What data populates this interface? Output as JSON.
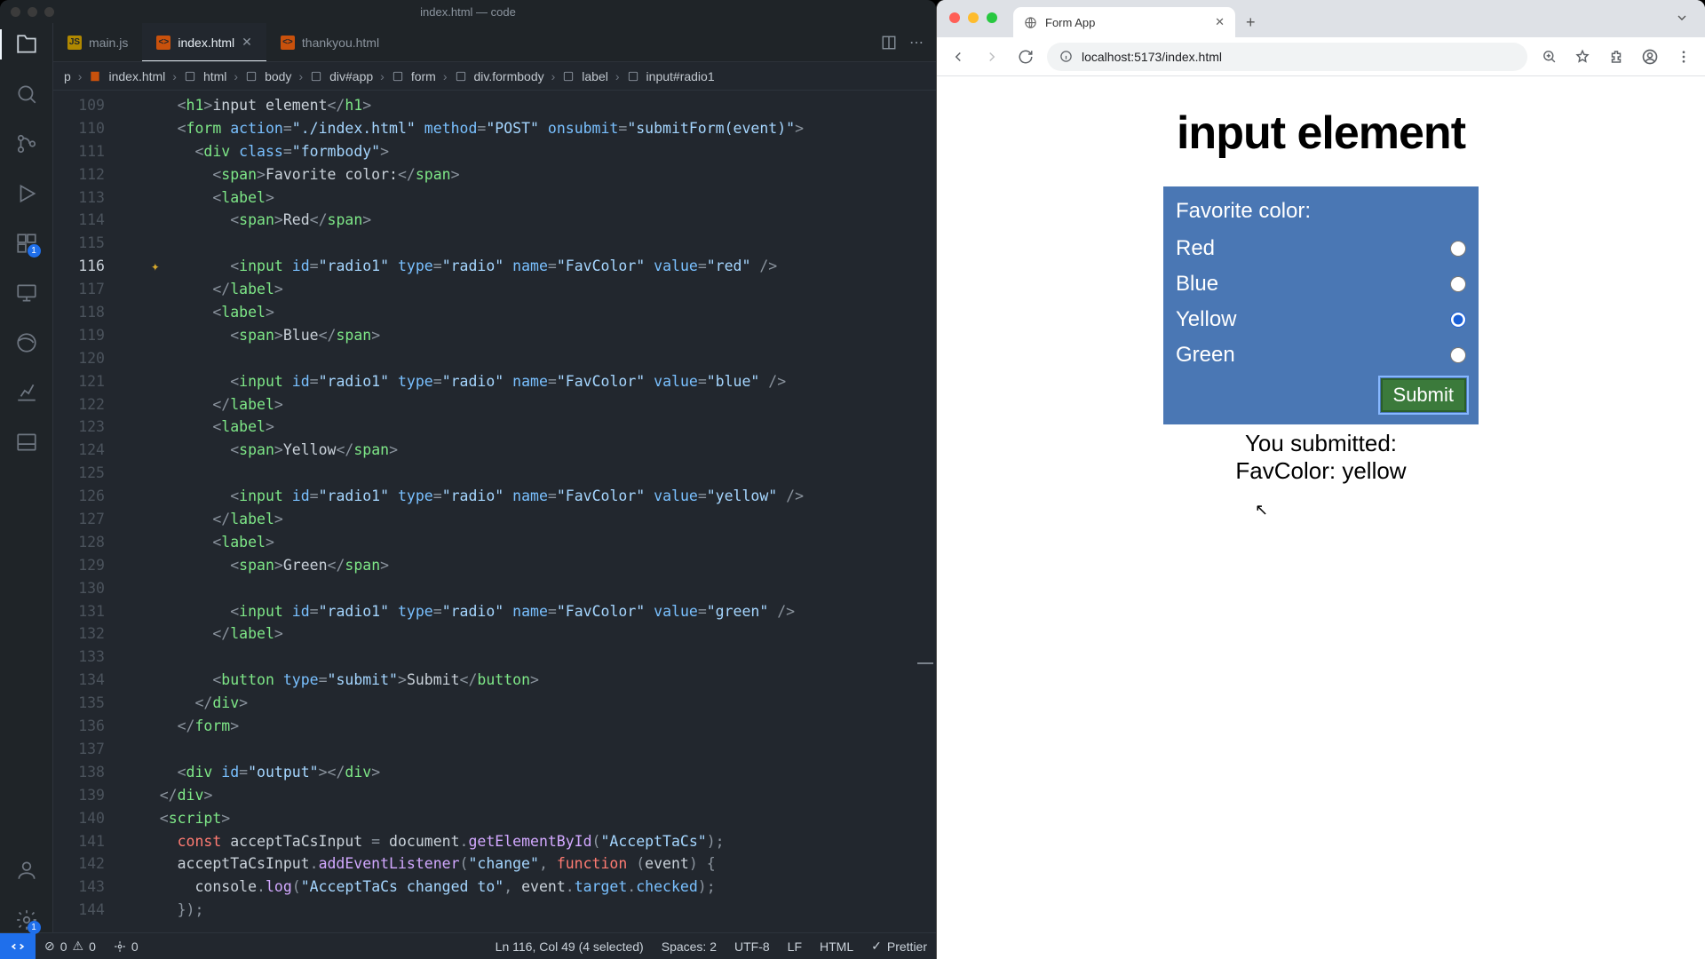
{
  "vscode": {
    "title": "index.html — code",
    "tabs": [
      {
        "icon": "JS",
        "icon_bg": "#b08800",
        "label": "main.js",
        "active": false
      },
      {
        "icon": "<>",
        "icon_bg": "#c9510c",
        "label": "index.html",
        "active": true
      },
      {
        "icon": "<>",
        "icon_bg": "#c9510c",
        "label": "thankyou.html",
        "active": false
      }
    ],
    "breadcrumbs": [
      "p",
      "index.html",
      "html",
      "body",
      "div#app",
      "form",
      "div.formbody",
      "label",
      "input#radio1"
    ],
    "line_start": 109,
    "line_end": 144,
    "highlight_line": 116,
    "status": {
      "errors": "0",
      "warnings": "0",
      "ports": "0",
      "cursor": "Ln 116, Col 49 (4 selected)",
      "spaces": "Spaces: 2",
      "encoding": "UTF-8",
      "eol": "LF",
      "lang": "HTML",
      "formatter": "Prettier"
    },
    "ext_badge": "1",
    "settings_badge": "1"
  },
  "browser": {
    "tab_title": "Form App",
    "url": "localhost:5173/index.html",
    "page": {
      "heading": "input element",
      "prompt": "Favorite color:",
      "options": [
        "Red",
        "Blue",
        "Yellow",
        "Green"
      ],
      "selected_index": 2,
      "submit_label": "Submit",
      "output_line1": "You submitted:",
      "output_line2": "FavColor: yellow"
    }
  },
  "code_lines": [
    {
      "n": 109,
      "html": "      <span class='t-pun'>&lt;</span><span class='t-tag'>h1</span><span class='t-pun'>&gt;</span><span class='t-txt'>input element</span><span class='t-pun'>&lt;/</span><span class='t-tag'>h1</span><span class='t-pun'>&gt;</span>"
    },
    {
      "n": 110,
      "html": "      <span class='t-pun'>&lt;</span><span class='t-tag'>form</span> <span class='t-attr'>action</span><span class='t-pun'>=</span><span class='t-str'>\"./index.html\"</span> <span class='t-attr'>method</span><span class='t-pun'>=</span><span class='t-str'>\"POST\"</span> <span class='t-attr'>onsubmit</span><span class='t-pun'>=</span><span class='t-str'>\"submitForm(event)\"</span><span class='t-pun'>&gt;</span>"
    },
    {
      "n": 111,
      "html": "        <span class='t-pun'>&lt;</span><span class='t-tag'>div</span> <span class='t-attr'>class</span><span class='t-pun'>=</span><span class='t-str'>\"formbody\"</span><span class='t-pun'>&gt;</span>"
    },
    {
      "n": 112,
      "html": "          <span class='t-pun'>&lt;</span><span class='t-tag'>span</span><span class='t-pun'>&gt;</span><span class='t-txt'>Favorite color:</span><span class='t-pun'>&lt;/</span><span class='t-tag'>span</span><span class='t-pun'>&gt;</span>"
    },
    {
      "n": 113,
      "html": "          <span class='t-pun'>&lt;</span><span class='t-tag'>label</span><span class='t-pun'>&gt;</span>"
    },
    {
      "n": 114,
      "html": "            <span class='t-pun'>&lt;</span><span class='t-tag'>span</span><span class='t-pun'>&gt;</span><span class='t-txt'>Red</span><span class='t-pun'>&lt;/</span><span class='t-tag'>span</span><span class='t-pun'>&gt;</span>"
    },
    {
      "n": 115,
      "html": ""
    },
    {
      "n": 116,
      "html": "            <span class='t-pun'>&lt;</span><span class='t-tag'>input</span> <span class='t-attr'>id</span><span class='t-pun'>=</span><span class='t-str'>\"radio1\"</span> <span class='t-attr'>type</span><span class='t-pun'>=</span><span class='t-str'>\"radio\"</span> <span class='t-attr'>name</span><span class='t-pun'>=</span><span class='t-str'>\"FavColor\"</span> <span class='t-attr'>value</span><span class='t-pun'>=</span><span class='t-str'>\"red\"</span> <span class='t-pun'>/&gt;</span>"
    },
    {
      "n": 117,
      "html": "          <span class='t-pun'>&lt;/</span><span class='t-tag'>label</span><span class='t-pun'>&gt;</span>"
    },
    {
      "n": 118,
      "html": "          <span class='t-pun'>&lt;</span><span class='t-tag'>label</span><span class='t-pun'>&gt;</span>"
    },
    {
      "n": 119,
      "html": "            <span class='t-pun'>&lt;</span><span class='t-tag'>span</span><span class='t-pun'>&gt;</span><span class='t-txt'>Blue</span><span class='t-pun'>&lt;/</span><span class='t-tag'>span</span><span class='t-pun'>&gt;</span>"
    },
    {
      "n": 120,
      "html": ""
    },
    {
      "n": 121,
      "html": "            <span class='t-pun'>&lt;</span><span class='t-tag'>input</span> <span class='t-attr'>id</span><span class='t-pun'>=</span><span class='t-str'>\"radio1\"</span> <span class='t-attr'>type</span><span class='t-pun'>=</span><span class='t-str'>\"radio\"</span> <span class='t-attr'>name</span><span class='t-pun'>=</span><span class='t-str'>\"FavColor\"</span> <span class='t-attr'>value</span><span class='t-pun'>=</span><span class='t-str'>\"blue\"</span> <span class='t-pun'>/&gt;</span>"
    },
    {
      "n": 122,
      "html": "          <span class='t-pun'>&lt;/</span><span class='t-tag'>label</span><span class='t-pun'>&gt;</span>"
    },
    {
      "n": 123,
      "html": "          <span class='t-pun'>&lt;</span><span class='t-tag'>label</span><span class='t-pun'>&gt;</span>"
    },
    {
      "n": 124,
      "html": "            <span class='t-pun'>&lt;</span><span class='t-tag'>span</span><span class='t-pun'>&gt;</span><span class='t-txt'>Yellow</span><span class='t-pun'>&lt;/</span><span class='t-tag'>span</span><span class='t-pun'>&gt;</span>"
    },
    {
      "n": 125,
      "html": ""
    },
    {
      "n": 126,
      "html": "            <span class='t-pun'>&lt;</span><span class='t-tag'>input</span> <span class='t-attr'>id</span><span class='t-pun'>=</span><span class='t-str'>\"radio1\"</span> <span class='t-attr'>type</span><span class='t-pun'>=</span><span class='t-str'>\"radio\"</span> <span class='t-attr'>name</span><span class='t-pun'>=</span><span class='t-str'>\"FavColor\"</span> <span class='t-attr'>value</span><span class='t-pun'>=</span><span class='t-str'>\"yellow\"</span> <span class='t-pun'>/&gt;</span>"
    },
    {
      "n": 127,
      "html": "          <span class='t-pun'>&lt;/</span><span class='t-tag'>label</span><span class='t-pun'>&gt;</span>"
    },
    {
      "n": 128,
      "html": "          <span class='t-pun'>&lt;</span><span class='t-tag'>label</span><span class='t-pun'>&gt;</span>"
    },
    {
      "n": 129,
      "html": "            <span class='t-pun'>&lt;</span><span class='t-tag'>span</span><span class='t-pun'>&gt;</span><span class='t-txt'>Green</span><span class='t-pun'>&lt;/</span><span class='t-tag'>span</span><span class='t-pun'>&gt;</span>"
    },
    {
      "n": 130,
      "html": ""
    },
    {
      "n": 131,
      "html": "            <span class='t-pun'>&lt;</span><span class='t-tag'>input</span> <span class='t-attr'>id</span><span class='t-pun'>=</span><span class='t-str'>\"radio1\"</span> <span class='t-attr'>type</span><span class='t-pun'>=</span><span class='t-str'>\"radio\"</span> <span class='t-attr'>name</span><span class='t-pun'>=</span><span class='t-str'>\"FavColor\"</span> <span class='t-attr'>value</span><span class='t-pun'>=</span><span class='t-str'>\"green\"</span> <span class='t-pun'>/&gt;</span>"
    },
    {
      "n": 132,
      "html": "          <span class='t-pun'>&lt;/</span><span class='t-tag'>label</span><span class='t-pun'>&gt;</span>"
    },
    {
      "n": 133,
      "html": ""
    },
    {
      "n": 134,
      "html": "          <span class='t-pun'>&lt;</span><span class='t-tag'>button</span> <span class='t-attr'>type</span><span class='t-pun'>=</span><span class='t-str'>\"submit\"</span><span class='t-pun'>&gt;</span><span class='t-txt'>Submit</span><span class='t-pun'>&lt;/</span><span class='t-tag'>button</span><span class='t-pun'>&gt;</span>"
    },
    {
      "n": 135,
      "html": "        <span class='t-pun'>&lt;/</span><span class='t-tag'>div</span><span class='t-pun'>&gt;</span>"
    },
    {
      "n": 136,
      "html": "      <span class='t-pun'>&lt;/</span><span class='t-tag'>form</span><span class='t-pun'>&gt;</span>"
    },
    {
      "n": 137,
      "html": ""
    },
    {
      "n": 138,
      "html": "      <span class='t-pun'>&lt;</span><span class='t-tag'>div</span> <span class='t-attr'>id</span><span class='t-pun'>=</span><span class='t-str'>\"output\"</span><span class='t-pun'>&gt;&lt;/</span><span class='t-tag'>div</span><span class='t-pun'>&gt;</span>"
    },
    {
      "n": 139,
      "html": "    <span class='t-pun'>&lt;/</span><span class='t-tag'>div</span><span class='t-pun'>&gt;</span>"
    },
    {
      "n": 140,
      "html": "    <span class='t-pun'>&lt;</span><span class='t-tag'>script</span><span class='t-pun'>&gt;</span>"
    },
    {
      "n": 141,
      "html": "      <span class='t-kw'>const</span> <span class='t-txt'>acceptTaCsInput</span> <span class='t-pun'>=</span> <span class='t-txt'>document</span><span class='t-pun'>.</span><span class='t-fn'>getElementById</span><span class='t-pun'>(</span><span class='t-str'>\"AcceptTaCs\"</span><span class='t-pun'>);</span>"
    },
    {
      "n": 142,
      "html": "      <span class='t-txt'>acceptTaCsInput</span><span class='t-pun'>.</span><span class='t-fn'>addEventListener</span><span class='t-pun'>(</span><span class='t-str'>\"change\"</span><span class='t-pun'>,</span> <span class='t-kw'>function</span> <span class='t-pun'>(</span><span class='t-txt'>event</span><span class='t-pun'>) {</span>"
    },
    {
      "n": 143,
      "html": "        <span class='t-txt'>console</span><span class='t-pun'>.</span><span class='t-fn'>log</span><span class='t-pun'>(</span><span class='t-str'>\"AcceptTaCs changed to\"</span><span class='t-pun'>,</span> <span class='t-txt'>event</span><span class='t-pun'>.</span><span class='t-prop'>target</span><span class='t-pun'>.</span><span class='t-prop'>checked</span><span class='t-pun'>);</span>"
    },
    {
      "n": 144,
      "html": "      <span class='t-pun'>});</span>"
    }
  ]
}
